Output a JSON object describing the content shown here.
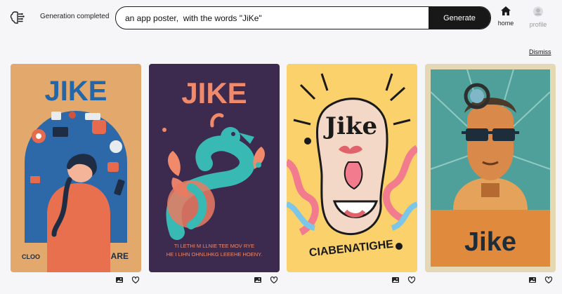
{
  "header": {
    "status_text": "Generation completed",
    "search": {
      "value": "an app poster,  with the words \"JiKe\""
    },
    "generate_label": "Generate",
    "nav": {
      "home_label": "home",
      "profile_label": "profile"
    },
    "dismiss_label": "Dismiss"
  },
  "gallery": [
    {
      "title": "JIKE",
      "caption_left": "CLOO",
      "caption_right": "ARE",
      "bg": "#e3a86b",
      "actions": [
        "image-icon",
        "heart-icon"
      ]
    },
    {
      "title": "JIKE",
      "caption_line1": "TI LETHI  M LLNIE TEE MOV RYE",
      "caption_line2": "HE I LIHN OHNLIHKG LEEEHE HOENY.",
      "bg": "#3c2a4f",
      "actions": [
        "image-icon",
        "heart-icon"
      ]
    },
    {
      "title": "Jike",
      "caption": "CIABENATIGHE",
      "bg": "#fbd16c",
      "actions": [
        "image-icon",
        "heart-icon"
      ]
    },
    {
      "title": "Jike",
      "bg": "#e5d8b5",
      "actions": [
        "image-icon",
        "heart-icon"
      ]
    }
  ]
}
